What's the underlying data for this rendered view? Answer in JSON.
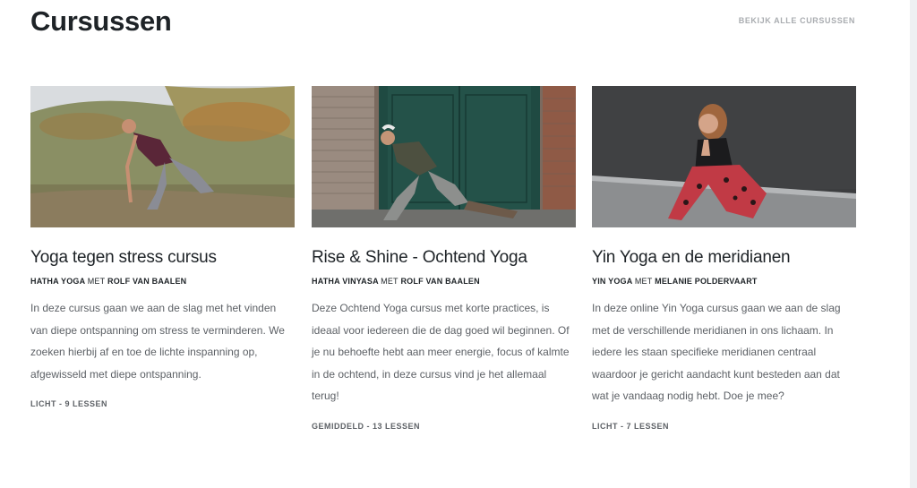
{
  "header": {
    "title": "Cursussen",
    "view_all": "BEKIJK ALLE CURSUSSEN"
  },
  "courses": [
    {
      "title": "Yoga tegen stress cursus",
      "style": "HATHA YOGA",
      "connector": "MET",
      "teacher": "ROLF VAN BAALEN",
      "description": "In deze cursus gaan we aan de slag met het vinden van diepe ontspanning om stress te verminderen. We zoeken hierbij af en toe de lichte inspanning op, afgewisseld met diepe ontspanning.",
      "level": "LICHT - 9 LESSEN",
      "image": "man-doing-yoga-in-dunes-photo"
    },
    {
      "title": "Rise & Shine - Ochtend Yoga",
      "style": "HATHA VINYASA",
      "connector": "MET",
      "teacher": "ROLF VAN BAALEN",
      "description": "Deze Ochtend Yoga cursus met korte practices, is ideaal voor iedereen die de dag goed wil beginnen. Of je nu behoefte hebt aan meer energie, focus of kalmte in de ochtend, in deze cursus vind je het allemaal terug!",
      "level": "GEMIDDELD - 13 LESSEN",
      "image": "man-in-lunge-pose-by-green-door-photo"
    },
    {
      "title": "Yin Yoga en de meridianen",
      "style": "YIN YOGA",
      "connector": "MET",
      "teacher": "MELANIE POLDERVAART",
      "description": "In deze online Yin Yoga cursus gaan we aan de slag met de verschillende meridianen in ons lichaam. In iedere les staan specifieke meridianen centraal waardoor je gericht aandacht kunt besteden aan dat wat je vandaag nodig hebt. Doe je mee?",
      "level": "LICHT - 7 LESSEN",
      "image": "woman-in-squat-pose-by-dark-wall-photo"
    }
  ]
}
